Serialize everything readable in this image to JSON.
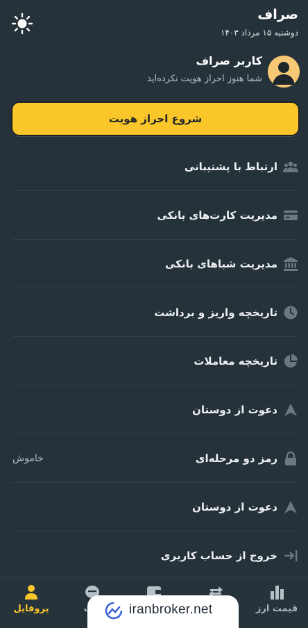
{
  "header": {
    "title": "صراف",
    "date": "دوشنبه ۱۵ مرداد ۱۴۰۳",
    "theme_icon": "sun-icon"
  },
  "user": {
    "name": "کاربر صراف",
    "status": "شما هنوز احراز هویت نکرده‌اید",
    "avatar_icon": "user-avatar-icon"
  },
  "kyc_button": {
    "label": "شروع احراز هویت"
  },
  "menu": [
    {
      "label": "ارتباط با پشتیبانی",
      "icon": "support-icon"
    },
    {
      "label": "مدیریت کارت‌های بانکی",
      "icon": "credit-card-icon"
    },
    {
      "label": "مدیریت شباهای بانکی",
      "icon": "bank-icon"
    },
    {
      "label": "تاریخچه واریز و برداشت",
      "icon": "clock-icon"
    },
    {
      "label": "تاریخچه معاملات",
      "icon": "pie-chart-icon"
    },
    {
      "label": "دعوت از دوستان",
      "icon": "invite-icon"
    },
    {
      "label": "رمز دو مرحله‌ای",
      "icon": "lock-icon",
      "value": "خاموش"
    },
    {
      "label": "دعوت از دوستان",
      "icon": "invite-icon"
    },
    {
      "label": "خروج از حساب کاربری",
      "icon": "logout-icon"
    }
  ],
  "bottom_nav": [
    {
      "label": "پروفایل",
      "icon": "profile-icon",
      "active": true
    },
    {
      "label": "ارت",
      "icon": "exchange-icon"
    },
    {
      "label": "",
      "icon": "wallet-icon"
    },
    {
      "label": "",
      "icon": "swap-icon"
    },
    {
      "label": "قیمت ارز",
      "icon": "bar-chart-icon"
    }
  ],
  "watermark": {
    "text": "iranbroker.net"
  },
  "colors": {
    "background": "#26323a",
    "accent": "#fac629",
    "text": "#e8ecef",
    "muted": "#b5bec4"
  }
}
